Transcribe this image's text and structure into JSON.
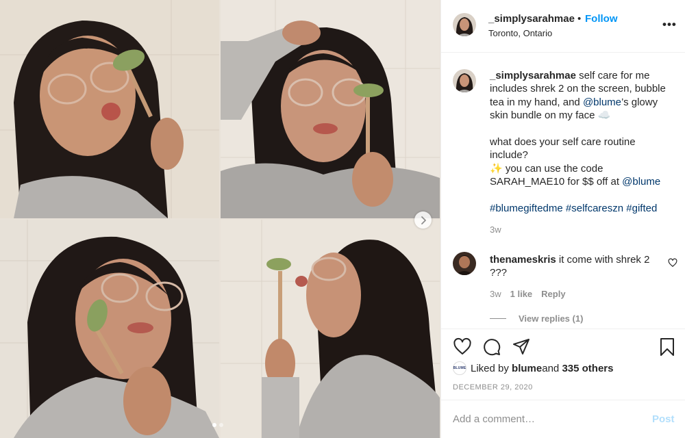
{
  "header": {
    "username": "_simplysarahmae",
    "separator": "•",
    "follow_label": "Follow",
    "location": "Toronto, Ontario",
    "more_icon": "more-horizontal-icon"
  },
  "media": {
    "next_icon": "chevron-right-icon",
    "slides": 2,
    "current_slide": 1
  },
  "caption": {
    "username": "_simplysarahmae",
    "line1_a": " self care for me includes shrek 2 on the screen, bubble tea in my hand, and ",
    "mention1": "@blume",
    "line1_b": "’s glowy skin bundle on my face ☁️",
    "line2": "what does your self care routine include?",
    "line3_a": "✨ you can use the code SARAH_MAE10 for $$ off at ",
    "mention2": "@blume",
    "hashtags": "#blumegiftedme #selfcareszn #gifted",
    "time": "3w"
  },
  "comment": {
    "username": "thenameskris",
    "text": " it come with shrek 2 ???",
    "time": "3w",
    "likes": "1 like",
    "reply": "Reply",
    "view_replies": "View replies (1)"
  },
  "actions": {
    "like_icon": "heart-icon",
    "comment_icon": "comment-bubble-icon",
    "share_icon": "paper-plane-icon",
    "save_icon": "bookmark-icon"
  },
  "likes": {
    "avatar_text": "BLUME",
    "prefix": "Liked by ",
    "user": "blume",
    "middle": " and ",
    "others": "335 others"
  },
  "date": "DECEMBER 29, 2020",
  "add_comment": {
    "placeholder": "Add a comment…",
    "post_label": "Post"
  },
  "colors": {
    "accent": "#0095f6",
    "muted": "#8e8e8e",
    "link": "#00376b",
    "post_disabled": "#b2dffc"
  }
}
